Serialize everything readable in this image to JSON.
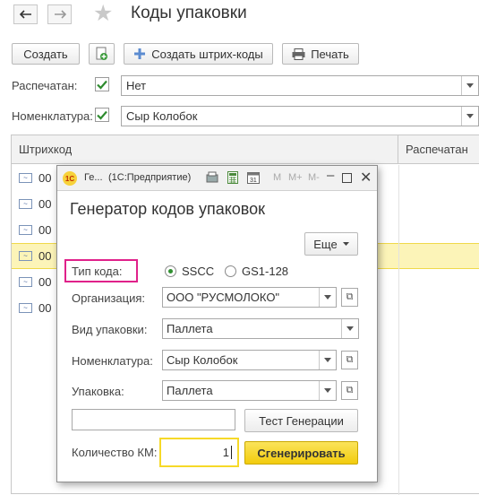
{
  "header": {
    "title": "Коды упаковки",
    "back_icon": "arrow-left-icon",
    "forward_icon": "arrow-right-icon",
    "favorite_icon": "star-icon"
  },
  "toolbar": {
    "create_label": "Создать",
    "create_barcodes_label": "Создать штрих-коды",
    "print_label": "Печать"
  },
  "filters": {
    "printed_label": "Распечатан:",
    "printed_value": "Нет",
    "nomenclature_label": "Номенклатура:",
    "nomenclature_value": "Сыр Колобок"
  },
  "table": {
    "columns": [
      "Штрихкод",
      "Распечатан"
    ],
    "rows": [
      "00",
      "00",
      "00",
      "00",
      "00",
      "00"
    ]
  },
  "dialog": {
    "window_title_short": "Ге...",
    "window_title_app": "(1С:Предприятие)",
    "toolbar_m": "M",
    "toolbar_mplus": "M+",
    "toolbar_mminus": "M-",
    "heading": "Генератор кодов упаковок",
    "more_label": "Еще",
    "code_type_label": "Тип кода:",
    "code_type_options": [
      "SSCC",
      "GS1-128"
    ],
    "org_label": "Организация:",
    "org_value": "ООО \"РУСМОЛОКО\"",
    "pack_type_label": "Вид упаковки:",
    "pack_type_value": "Паллета",
    "nomenclature_label": "Номенклатура:",
    "nomenclature_value": "Сыр Колобок",
    "pack_label": "Упаковка:",
    "pack_value": "Паллета",
    "test_label": "Тест Генерации",
    "test_output": "",
    "count_label": "Количество КМ:",
    "count_value": "1",
    "generate_label": "Сгенерировать"
  },
  "colors": {
    "accent_yellow": "#f6d928",
    "highlight_pink": "#e0218a",
    "check_green": "#2e8b2e",
    "selected_row": "#fcf4b8"
  }
}
